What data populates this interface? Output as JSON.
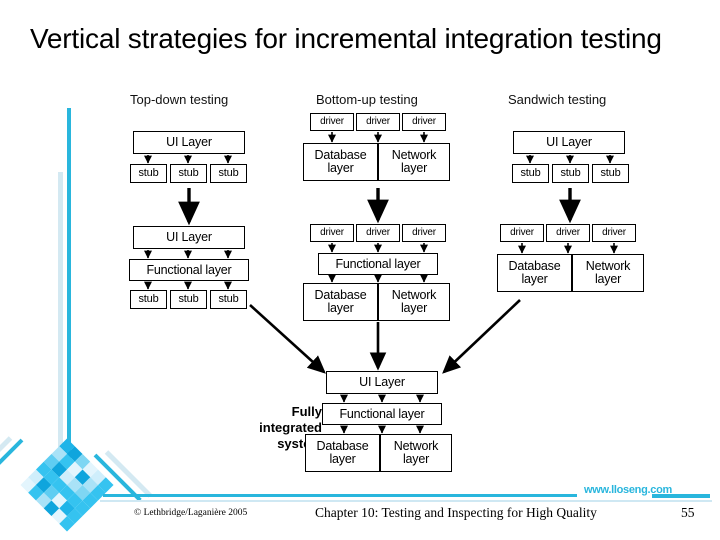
{
  "slide": {
    "title": "Vertical strategies for incremental integration testing"
  },
  "diagram": {
    "columns": [
      {
        "id": "top-down",
        "heading": "Top-down testing"
      },
      {
        "id": "bottom-up",
        "heading": "Bottom-up testing"
      },
      {
        "id": "sandwich",
        "heading": "Sandwich testing"
      }
    ],
    "labels": {
      "ui_layer": "UI Layer",
      "functional_layer": "Functional layer",
      "database_layer": "Database layer",
      "network_layer": "Network layer",
      "stub": "stub",
      "driver": "driver",
      "fully_integrated": "Fully integrated system"
    },
    "top_down": {
      "stage1": {
        "top": "UI Layer",
        "children": [
          "stub",
          "stub",
          "stub"
        ]
      },
      "stage2": {
        "top": "UI Layer",
        "middle": "Functional layer",
        "children": [
          "stub",
          "stub",
          "stub"
        ]
      }
    },
    "bottom_up": {
      "stage1": {
        "drivers": [
          "driver",
          "driver",
          "driver"
        ],
        "bottom": [
          "Database layer",
          "Network layer"
        ]
      },
      "stage2": {
        "drivers": [
          "driver",
          "driver",
          "driver"
        ],
        "middle": "Functional layer",
        "bottom": [
          "Database layer",
          "Network layer"
        ]
      }
    },
    "sandwich": {
      "stage1": {
        "top": "UI Layer",
        "children": [
          "stub",
          "stub",
          "stub"
        ]
      },
      "stage2": {
        "drivers": [
          "driver",
          "driver",
          "driver"
        ],
        "bottom": [
          "Database layer",
          "Network layer"
        ]
      }
    },
    "integrated_system": {
      "caption_line1": "Fully",
      "caption_line2": "integrated",
      "caption_line3": "system",
      "top": "UI Layer",
      "middle": "Functional layer",
      "bottom": [
        "Database layer",
        "Network layer"
      ]
    }
  },
  "footer": {
    "copyright": "© Lethbridge/Laganière 2005",
    "chapter": "Chapter 10: Testing and Inspecting for High Quality",
    "page_number": "55",
    "website": "www.lloseng.com"
  },
  "colors": {
    "accent_cyan": "#29b6dd",
    "accent_pale": "#d4e9f2",
    "text": "#000000",
    "background": "#ffffff"
  }
}
